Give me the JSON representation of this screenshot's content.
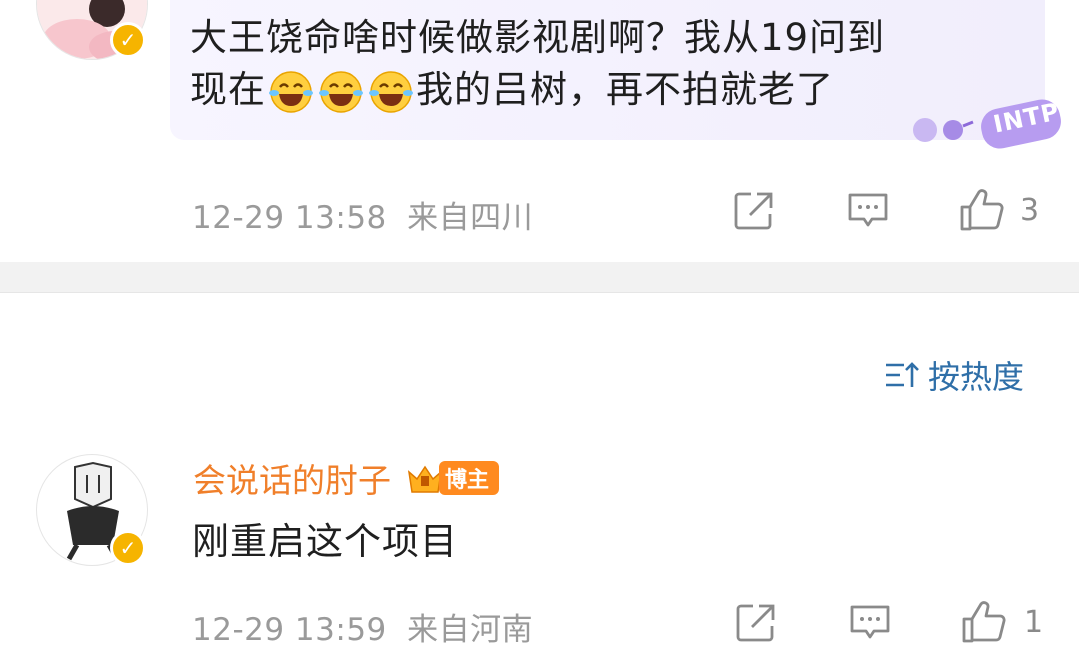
{
  "comments": [
    {
      "text_part1": "大王饶命啥时候做影视剧啊？我从19问到",
      "text_part2_before": "现在",
      "emoji_count": 3,
      "emoji_name": "laugh-cry-emoji",
      "text_part2_after": "我的吕树，再不拍就老了",
      "badge_text": "INTP",
      "timestamp": "12-29 13:58",
      "location": "来自四川",
      "like_count": "3"
    },
    {
      "username": "会说话的肘子",
      "role_badge": "博主",
      "text": "刚重启这个项目",
      "timestamp": "12-29 13:59",
      "location": "来自河南",
      "like_count": "1"
    }
  ],
  "sort": {
    "label": "按热度",
    "icon": "sort-icon"
  },
  "colors": {
    "username": "#f07f2a",
    "sort": "#2f6fa8",
    "verified": "#f6b400"
  }
}
